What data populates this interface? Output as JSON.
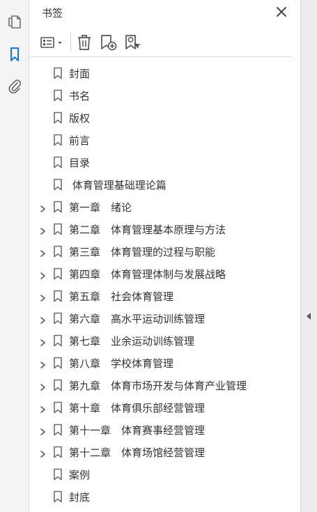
{
  "panel": {
    "title": "书签"
  },
  "left_tools": [
    {
      "name": "pages-icon"
    },
    {
      "name": "bookmarks-icon"
    },
    {
      "name": "attachments-icon"
    }
  ],
  "toolbar": {
    "options_icon": "list-options-icon",
    "delete_icon": "trash-icon",
    "new_bookmark_icon": "add-bookmark-icon",
    "find_bookmark_icon": "find-bookmark-icon"
  },
  "bookmarks": [
    {
      "label": "封面",
      "expandable": false
    },
    {
      "label": "书名",
      "expandable": false
    },
    {
      "label": "版权",
      "expandable": false
    },
    {
      "label": "前言",
      "expandable": false
    },
    {
      "label": "目录",
      "expandable": false
    },
    {
      "label": " 体育管理基础理论篇",
      "expandable": false
    },
    {
      "label": "第一章　绪论",
      "expandable": true
    },
    {
      "label": "第二章　体育管理基本原理与方法",
      "expandable": true
    },
    {
      "label": "第三章　体育管理的过程与职能",
      "expandable": true
    },
    {
      "label": "第四章　体育管理体制与发展战略",
      "expandable": true
    },
    {
      "label": "第五章　社会体育管理",
      "expandable": true
    },
    {
      "label": "第六章　高水平运动训练管理",
      "expandable": true
    },
    {
      "label": "第七章　业余运动训练管理",
      "expandable": true
    },
    {
      "label": "第八章　学校体育管理",
      "expandable": true
    },
    {
      "label": "第九章　体育市场开发与体育产业管理",
      "expandable": true
    },
    {
      "label": "第十章　体育俱乐部经营管理",
      "expandable": true
    },
    {
      "label": "第十一章　体育赛事经营管理",
      "expandable": true
    },
    {
      "label": "第十二章　体育场馆经营管理",
      "expandable": true
    },
    {
      "label": "案例",
      "expandable": false
    },
    {
      "label": "封底",
      "expandable": false
    }
  ],
  "colors": {
    "active_blue": "#1473e6",
    "icon_gray": "#6e6e6e",
    "text": "#333333"
  }
}
